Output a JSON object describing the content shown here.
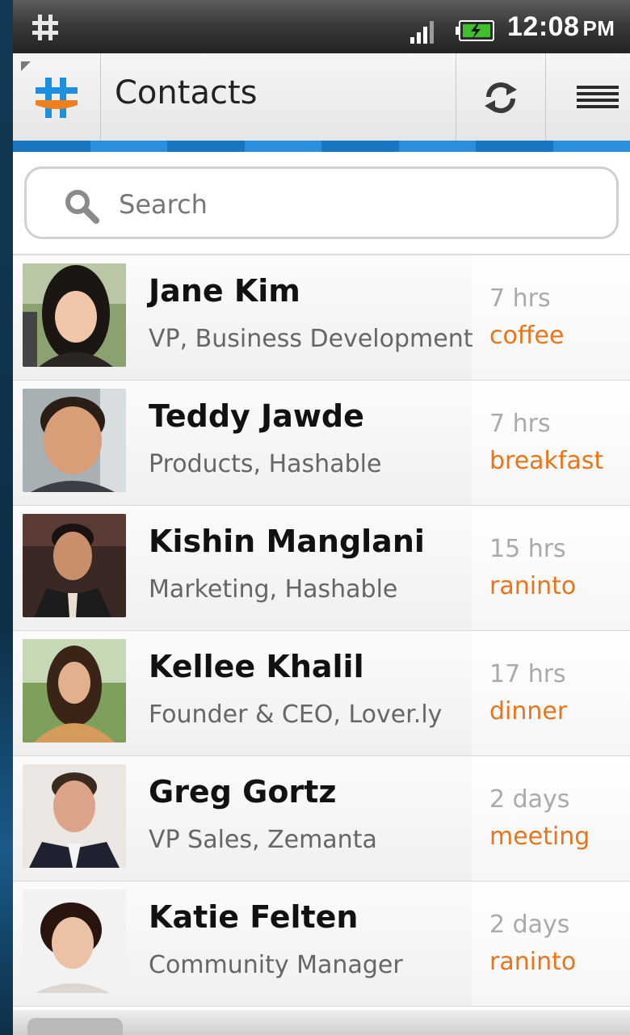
{
  "status_bar": {
    "app_icon": "hash-icon",
    "time": "12:08",
    "ampm": "PM",
    "signal_icon": "signal-bars-icon",
    "battery_icon": "battery-charging-icon"
  },
  "action_bar": {
    "logo_icon": "hashable-logo-icon",
    "title": "Contacts",
    "refresh_icon": "refresh-icon",
    "menu_icon": "menu-icon"
  },
  "colors": {
    "accent_blue": "#1b7ccc",
    "activity_orange": "#e8751a",
    "logo_blue": "#1d8fe0",
    "logo_orange": "#f07f1e"
  },
  "search": {
    "placeholder": "Search",
    "value": "",
    "icon": "search-icon"
  },
  "contacts": [
    {
      "name": "Jane Kim",
      "role": "VP, Business Development",
      "time": "7 hrs",
      "activity": "coffee"
    },
    {
      "name": "Teddy Jawde",
      "role": "Products, Hashable",
      "time": "7 hrs",
      "activity": "breakfast"
    },
    {
      "name": "Kishin Manglani",
      "role": "Marketing, Hashable",
      "time": "15 hrs",
      "activity": "raninto"
    },
    {
      "name": "Kellee Khalil",
      "role": "Founder & CEO, Lover.ly",
      "time": "17 hrs",
      "activity": "dinner"
    },
    {
      "name": "Greg Gortz",
      "role": "VP Sales, Zemanta",
      "time": "2 days",
      "activity": "meeting"
    },
    {
      "name": "Katie Felten",
      "role": "Community Manager",
      "time": "2 days",
      "activity": "raninto"
    }
  ]
}
